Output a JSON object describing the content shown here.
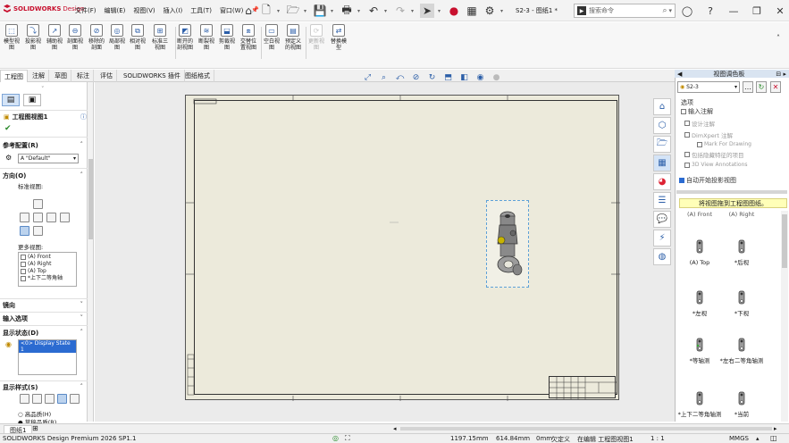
{
  "app": {
    "brand": "SOLIDWORKS",
    "product": "Design",
    "menus": [
      "文件(F)",
      "编辑(E)",
      "视图(V)",
      "插入(I)",
      "工具(T)",
      "窗口(W)"
    ],
    "doc_title": "S2-3 - 图纸1 *",
    "search_placeholder": "搜索命令",
    "accent": "#c8102e",
    "qat_icons": [
      "home-icon",
      "new-document-icon",
      "open-folder-icon",
      "save-icon",
      "print-icon",
      "undo-icon",
      "redo-icon",
      "select-arrow-icon",
      "traffic-light-icon",
      "file-properties-icon",
      "options-gear-icon"
    ],
    "window_controls": [
      "user-account-icon",
      "help-icon",
      "minimize-icon",
      "restore-icon",
      "close-icon"
    ]
  },
  "ribbon": {
    "buttons": [
      {
        "label": "模型视图",
        "icon": "model-view-icon",
        "enabled": true
      },
      {
        "label": "投影视图",
        "icon": "projected-view-icon",
        "enabled": true
      },
      {
        "label": "辅助视图",
        "icon": "auxiliary-view-icon",
        "enabled": true
      },
      {
        "label": "剖面视图",
        "icon": "section-view-icon",
        "enabled": true
      },
      {
        "label": "移除的剖面",
        "icon": "removed-section-icon",
        "enabled": true
      },
      {
        "label": "局部视图",
        "icon": "detail-view-icon",
        "enabled": true
      },
      {
        "label": "相对视图",
        "icon": "relative-view-icon",
        "enabled": true
      },
      {
        "label": "标准三视图",
        "icon": "standard-3-view-icon",
        "enabled": true
      },
      {
        "label": "断开的剖视图",
        "icon": "broken-out-section-icon",
        "enabled": true
      },
      {
        "label": "断裂视图",
        "icon": "break-view-icon",
        "enabled": true
      },
      {
        "label": "剪裁视图",
        "icon": "crop-view-icon",
        "enabled": true
      },
      {
        "label": "交替位置视图",
        "icon": "alternate-position-icon",
        "enabled": true
      },
      {
        "label": "空白视图",
        "icon": "empty-view-icon",
        "enabled": true
      },
      {
        "label": "预定义的视图",
        "icon": "predefined-view-icon",
        "enabled": true
      },
      {
        "label": "更新视图",
        "icon": "update-view-icon",
        "enabled": false
      },
      {
        "label": "替换模型",
        "icon": "replace-model-icon",
        "enabled": true
      }
    ]
  },
  "tabs": [
    "工程图",
    "注解",
    "草图",
    "标注",
    "评估",
    "SOLIDWORKS 插件",
    "图纸格式"
  ],
  "left_panel": {
    "title": "工程图视图1",
    "ref_config_label": "参考配置(R)",
    "ref_config_value": "\"Default\"",
    "orientation_label": "方向(O)",
    "standard_views_label": "标准视图:",
    "more_views_label": "更多视图:",
    "more_views": [
      "(A) Front",
      "(A) Right",
      "(A) Top",
      "*上下二等角轴"
    ],
    "import_section": "输入选项",
    "heading_section": "镜向",
    "display_state_label": "显示状态(D)",
    "display_state_item": "<0> Display State 1",
    "display_style_label": "显示样式(S)",
    "style_options": [
      "高品质(H)",
      "草稿品质(R)"
    ]
  },
  "palette": {
    "header": "视图调色板",
    "doc_select": "S2-3",
    "options_label": "选项",
    "options": [
      {
        "label": "输入注解",
        "checked": false,
        "enabled": true
      },
      {
        "label": "设计注解",
        "checked": false,
        "enabled": false
      },
      {
        "label": "DimXpert 注解",
        "checked": false,
        "enabled": false
      },
      {
        "label": "Mark For Drawing",
        "checked": false,
        "enabled": false
      },
      {
        "label": "包括隐藏特征的项目",
        "checked": false,
        "enabled": false
      },
      {
        "label": "3D View Annotations",
        "checked": false,
        "enabled": false
      }
    ],
    "auto_projection": "自动开始投影视图",
    "drag_hint": "将视图拖到工程图图纸。",
    "partial_labels": [
      "(A) Front",
      "(A) Right"
    ],
    "views": [
      {
        "label": "(A) Top"
      },
      {
        "label": "*后视"
      },
      {
        "label": "*左视"
      },
      {
        "label": "*下视"
      },
      {
        "label": "*等轴测"
      },
      {
        "label": "*左右二等角轴测"
      },
      {
        "label": "*上下二等角轴测"
      },
      {
        "label": "*当前"
      }
    ]
  },
  "sheet_tab": "图纸1",
  "status": {
    "product": "SOLIDWORKS Design Premium 2026 SP1.1",
    "x": "1197.15mm",
    "y": "614.84mm",
    "z": "0mm",
    "define_state": "欠定义",
    "editing": "在编辑 工程图视图1",
    "scale": "1 : 1",
    "units": "MMGS"
  }
}
